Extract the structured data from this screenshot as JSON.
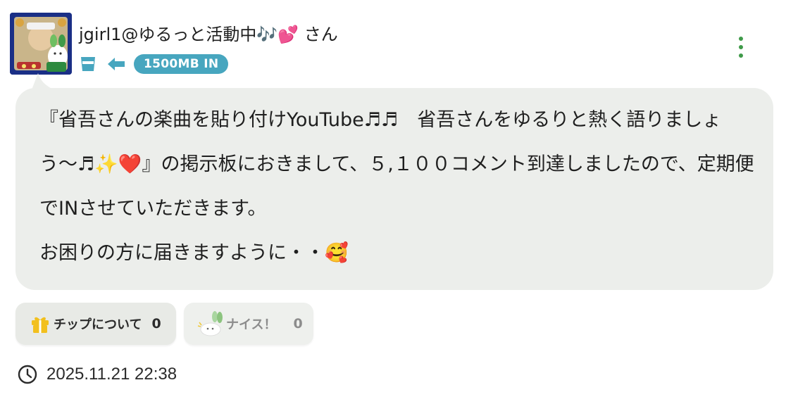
{
  "user": {
    "name": "jgirl1@ゆるっと活動中🎶💕 さん",
    "badge": "1500MB IN"
  },
  "post": {
    "paragraphs": [
      "『省吾さんの楽曲を貼り付けYouTube♬♬　省吾さんをゆるりと熱く語りましょう〜♬✨❤️』の掲示板におきまして、５,１００コメント到達しましたので、定期便でINさせていただきます。",
      "お困りの方に届きますように・・🥰"
    ]
  },
  "actions": {
    "tip_label": "チップについて",
    "tip_count": "0",
    "nice_label": "ナイス！",
    "nice_count": "0"
  },
  "timestamp": "2025.11.21 22:38",
  "icons": {
    "cup": "cup-icon",
    "arrow": "arrow-left-icon",
    "more": "more-vertical-icon",
    "gift": "gift-icon",
    "nice": "rabbit-nice-icon",
    "clock": "clock-icon"
  },
  "colors": {
    "accent_green": "#3f9a49",
    "badge_blue": "#47a6bf",
    "bubble_bg": "#eceeeb",
    "gift_yellow": "#f2c01e"
  }
}
